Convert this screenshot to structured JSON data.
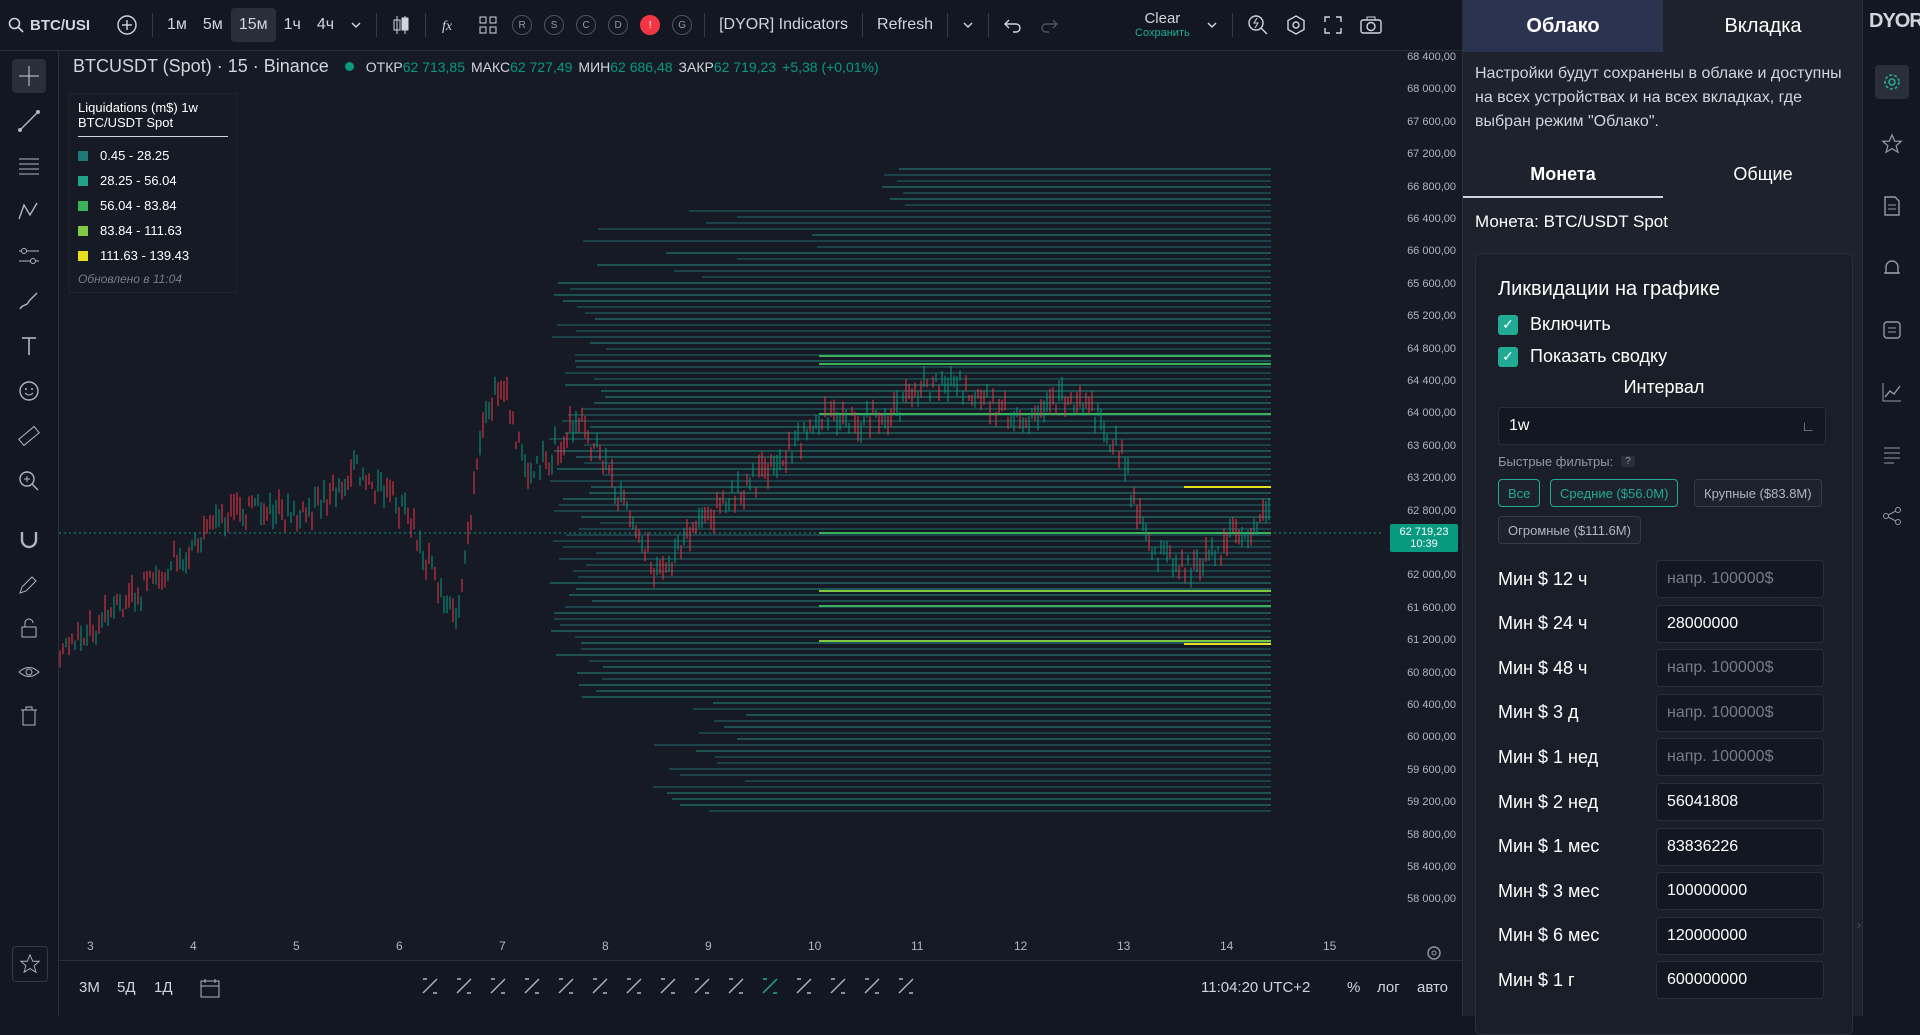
{
  "topbar": {
    "symbol": "BTC/USI",
    "intervals": [
      "1м",
      "5м",
      "15м",
      "1ч",
      "4ч"
    ],
    "active_interval": "15м",
    "indicator_badges": [
      "R",
      "S",
      "C",
      "D",
      "!",
      "G"
    ],
    "indicators_label": "[DYOR] Indicators",
    "refresh_label": "Refresh",
    "clear_label": "Clear",
    "save_label": "Сохранить"
  },
  "chart": {
    "title": "BTCUSDT (Spot) · 15 · Binance",
    "ohlc": {
      "open_label": "ОТКР",
      "open": "62 713,85",
      "high_label": "МАКС",
      "high": "62 727,49",
      "low_label": "МИН",
      "low": "62 686,48",
      "close_label": "ЗАКР",
      "close": "62 719,23",
      "change": "+5,38 (+0,01%)"
    },
    "current_price": "62 719,23",
    "current_time": "10:39",
    "price_ticks": [
      "68 400,00",
      "68 000,00",
      "67 600,00",
      "67 200,00",
      "66 800,00",
      "66 400,00",
      "66 000,00",
      "65 600,00",
      "65 200,00",
      "64 800,00",
      "64 400,00",
      "64 000,00",
      "63 600,00",
      "63 200,00",
      "62 800,00",
      "62 400,00",
      "62 000,00",
      "61 600,00",
      "61 200,00",
      "60 800,00",
      "60 400,00",
      "60 000,00",
      "59 600,00",
      "59 200,00",
      "58 800,00",
      "58 400,00",
      "58 000,00"
    ],
    "time_ticks": [
      "3",
      "4",
      "5",
      "6",
      "7",
      "8",
      "9",
      "10",
      "11",
      "12",
      "13",
      "14",
      "15"
    ]
  },
  "legend": {
    "title": "Liquidations (m$) 1w",
    "subtitle": "BTC/USDT Spot",
    "items": [
      {
        "label": "0.45 - 28.25",
        "color": "#1f7a77"
      },
      {
        "label": "28.25 - 56.04",
        "color": "#23a08a"
      },
      {
        "label": "56.04 - 83.84",
        "color": "#3cb15c"
      },
      {
        "label": "83.84 - 111.63",
        "color": "#7ec843"
      },
      {
        "label": "111.63 - 139.43",
        "color": "#e6e020"
      }
    ],
    "updated": "Обновлено в 11:04"
  },
  "bottombar": {
    "ranges": [
      "3М",
      "5Д",
      "1Д"
    ],
    "clock": "11:04:20 UTC+2",
    "percent": "%",
    "log": "лог",
    "auto": "авто"
  },
  "panel": {
    "tab_cloud": "Облако",
    "tab_local": "Вкладка",
    "notice": "Настройки будут сохранены в облаке и доступны на всех устройствах и на всех вкладках, где выбран режим \"Облако\".",
    "subtab_coin": "Монета",
    "subtab_general": "Общие",
    "coin_label": "Монета: BTC/USDT Spot",
    "section_title": "Ликвидации на графике",
    "enable_label": "Включить",
    "summary_label": "Показать сводку",
    "interval_title": "Интервал",
    "interval_value": "1w",
    "quick_filters_label": "Быстрые фильтры:",
    "help": "?",
    "filters": [
      "Все",
      "Средние ($56.0M)",
      "Крупные ($83.8M)",
      "Огромные ($111.6M)"
    ],
    "rows": [
      {
        "label": "Мин $ 12 ч",
        "value": "",
        "placeholder": "напр. 100000$"
      },
      {
        "label": "Мин $ 24 ч",
        "value": "28000000",
        "placeholder": ""
      },
      {
        "label": "Мин $ 48 ч",
        "value": "",
        "placeholder": "напр. 100000$"
      },
      {
        "label": "Мин $ 3 д",
        "value": "",
        "placeholder": "напр. 100000$"
      },
      {
        "label": "Мин $ 1 нед",
        "value": "",
        "placeholder": "напр. 100000$"
      },
      {
        "label": "Мин $ 2 нед",
        "value": "56041808",
        "placeholder": ""
      },
      {
        "label": "Мин $ 1 мес",
        "value": "83836226",
        "placeholder": ""
      },
      {
        "label": "Мин $ 3 мес",
        "value": "100000000",
        "placeholder": ""
      },
      {
        "label": "Мин $ 6 мес",
        "value": "120000000",
        "placeholder": ""
      },
      {
        "label": "Мин $ 1 г",
        "value": "600000000",
        "placeholder": ""
      }
    ]
  },
  "colors": {
    "up": "#089981",
    "down": "#f23645",
    "accent": "#22ab94",
    "bg": "#161a25"
  }
}
